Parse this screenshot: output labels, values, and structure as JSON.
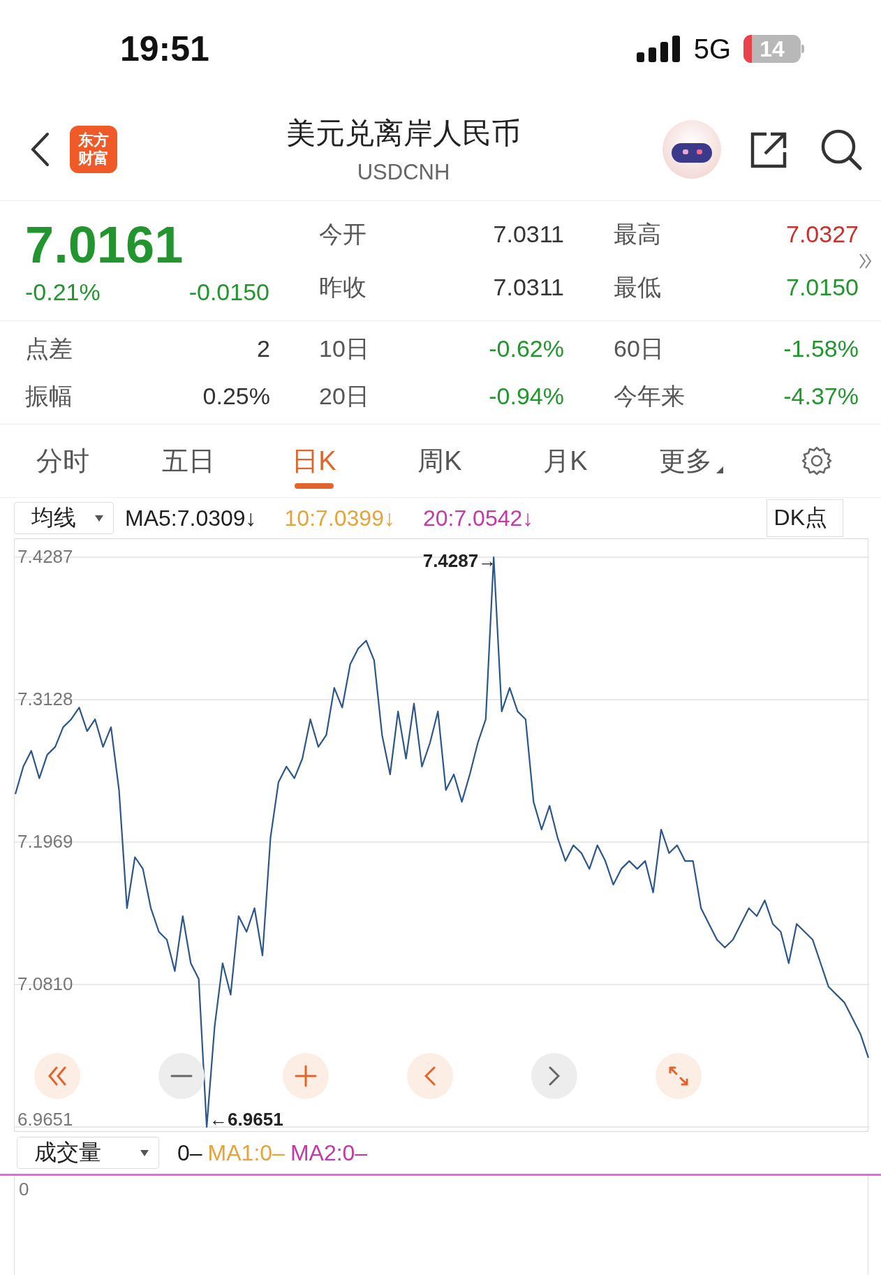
{
  "status_bar": {
    "time": "19:51",
    "network": "5G",
    "battery": "14"
  },
  "header": {
    "logo_text": [
      "东方",
      "财富"
    ],
    "title": "美元兑离岸人民币",
    "code": "USDCNH"
  },
  "quote": {
    "price": "7.0161",
    "change_pct": "-0.21%",
    "change": "-0.0150",
    "color": "#23952f"
  },
  "stats": [
    {
      "label": "今开",
      "value": "7.0311",
      "color": "#333333"
    },
    {
      "label": "最高",
      "value": "7.0327",
      "color": "#c8302c"
    },
    {
      "label": "昨收",
      "value": "7.0311",
      "color": "#333333"
    },
    {
      "label": "最低",
      "value": "7.0150",
      "color": "#23952f"
    }
  ],
  "more_stats": [
    {
      "label": "点差",
      "value": "2",
      "color": "#333333"
    },
    {
      "label": "10日",
      "value": "-0.62%",
      "color": "#23952f"
    },
    {
      "label": "60日",
      "value": "-1.58%",
      "color": "#23952f"
    },
    {
      "label": "振幅",
      "value": "0.25%",
      "color": "#333333"
    },
    {
      "label": "20日",
      "value": "-0.94%",
      "color": "#23952f"
    },
    {
      "label": "今年来",
      "value": "-4.37%",
      "color": "#23952f"
    }
  ],
  "tabs": [
    {
      "label": "分时",
      "selected": false,
      "menu": false
    },
    {
      "label": "五日",
      "selected": false,
      "menu": false
    },
    {
      "label": "日K",
      "selected": true,
      "menu": false
    },
    {
      "label": "周K",
      "selected": false,
      "menu": false
    },
    {
      "label": "月K",
      "selected": false,
      "menu": false
    },
    {
      "label": "更多",
      "selected": false,
      "menu": true
    }
  ],
  "indicator": {
    "dropdown": "均线",
    "mode": "DK点",
    "items": [
      {
        "text": "MA5:7.0309↓",
        "color": "#1e1e1e"
      },
      {
        "text": "10:7.0399↓",
        "color": "#e5a43a"
      },
      {
        "text": "20:7.0542↓",
        "color": "#c23aa6"
      }
    ]
  },
  "chart_data": {
    "type": "line",
    "ylim": [
      6.9651,
      7.4287
    ],
    "yticks": [
      {
        "value": 7.4287,
        "label": "7.4287"
      },
      {
        "value": 7.3128,
        "label": "7.3128"
      },
      {
        "value": 7.1969,
        "label": "7.1969"
      },
      {
        "value": 7.081,
        "label": "7.0810"
      },
      {
        "value": 6.9651,
        "label": "6.9651"
      }
    ],
    "grid": true,
    "annotations": [
      "7.4287→",
      "←6.9651"
    ],
    "series": [
      {
        "color": "#2c5788",
        "values": [
          7.236,
          7.2584,
          7.2712,
          7.2488,
          7.268,
          7.2744,
          7.2904,
          7.2968,
          7.3064,
          7.2872,
          7.2968,
          7.2744,
          7.2904,
          7.2392,
          7.1431,
          7.1847,
          7.1751,
          7.1431,
          7.1239,
          7.1175,
          7.0919,
          7.1367,
          7.0983,
          7.0855,
          6.9651,
          7.0471,
          7.0983,
          7.0727,
          7.1367,
          7.1239,
          7.1431,
          7.1047,
          7.2007,
          7.2456,
          7.2584,
          7.2488,
          7.2648,
          7.2968,
          7.2744,
          7.284,
          7.3224,
          7.3064,
          7.3416,
          7.3544,
          7.3608,
          7.3448,
          7.284,
          7.252,
          7.3032,
          7.2648,
          7.3096,
          7.2584,
          7.2776,
          7.3032,
          7.2392,
          7.252,
          7.2296,
          7.252,
          7.2776,
          7.2968,
          7.4287,
          7.3032,
          7.3224,
          7.3032,
          7.2968,
          7.2296,
          7.2071,
          7.2264,
          7.2007,
          7.1815,
          7.1943,
          7.1879,
          7.1751,
          7.1943,
          7.1815,
          7.1623,
          7.1751,
          7.1815,
          7.1751,
          7.1815,
          7.1559,
          7.2071,
          7.1879,
          7.1943,
          7.1815,
          7.1815,
          7.1431,
          7.1303,
          7.1175,
          7.1111,
          7.1175,
          7.1303,
          7.1431,
          7.1367,
          7.1495,
          7.1303,
          7.1239,
          7.0983,
          7.1303,
          7.1239,
          7.1175,
          7.0983,
          7.0791,
          7.0727,
          7.0663,
          7.0535,
          7.0407,
          7.0214
        ]
      }
    ]
  },
  "chart_controls": [
    {
      "kind": "first",
      "active": true
    },
    {
      "kind": "zoom-out",
      "active": false
    },
    {
      "kind": "zoom-in",
      "active": true
    },
    {
      "kind": "prev",
      "active": true
    },
    {
      "kind": "next",
      "active": false
    },
    {
      "kind": "expand",
      "active": true
    }
  ],
  "volume": {
    "dropdown": "成交量",
    "axis_label": "0",
    "items": [
      {
        "text": "0–",
        "color": "#1e1e1e"
      },
      {
        "text": "MA1:0–",
        "color": "#e5a43a"
      },
      {
        "text": "MA2:0–",
        "color": "#c23aa6"
      }
    ]
  }
}
